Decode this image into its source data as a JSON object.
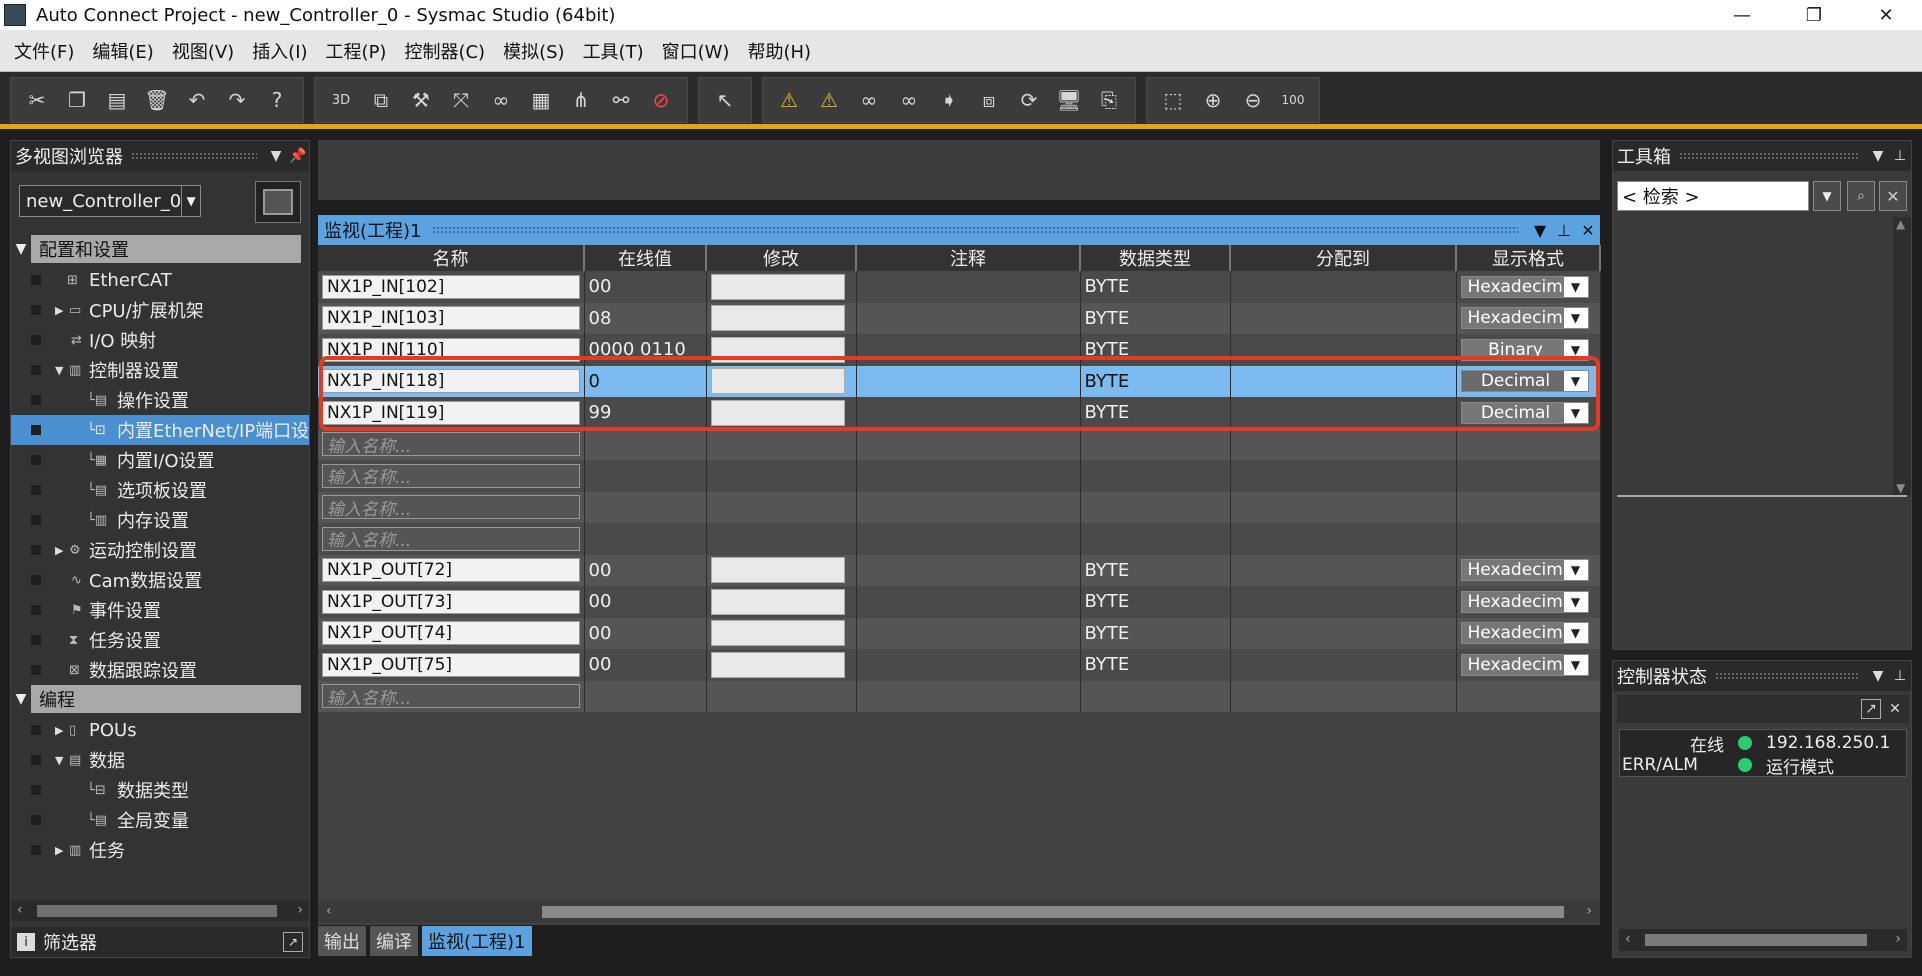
{
  "window": {
    "title": "Auto Connect Project - new_Controller_0 - Sysmac Studio (64bit)",
    "minimize": "—",
    "maximize": "❐",
    "close": "✕"
  },
  "menu": [
    "文件(F)",
    "编辑(E)",
    "视图(V)",
    "插入(I)",
    "工程(P)",
    "控制器(C)",
    "模拟(S)",
    "工具(T)",
    "窗口(W)",
    "帮助(H)"
  ],
  "toolbar": {
    "group1": [
      "scissors-icon",
      "copy-icon",
      "paste-icon",
      "delete-icon",
      "undo-icon",
      "redo-icon",
      "help-icon"
    ],
    "group2": [
      "3d-view-icon",
      "windows-icon",
      "build-icon",
      "cross-ref-icon",
      "glasses-icon",
      "table-icon",
      "structure-icon",
      "binoculars-icon",
      "error-icon"
    ],
    "group3": [
      "arrow-tool-icon"
    ],
    "group4": [
      "warning-icon",
      "warning-cross-icon",
      "watch-icon",
      "watch-cross-icon",
      "transfer-icon",
      "sync-icon",
      "refresh-icon",
      "online-icon",
      "offline-icon"
    ],
    "group5": [
      "fit-icon",
      "zoom-in-icon",
      "zoom-out-icon",
      "zoom-100-icon"
    ],
    "accent_color": "#e3a60f"
  },
  "left_panel": {
    "title": "多视图浏览器",
    "controller": "new_Controller_0",
    "section_config": "配置和设置",
    "section_program": "编程",
    "items": [
      {
        "label": "EtherCAT"
      },
      {
        "label": "CPU/扩展机架"
      },
      {
        "label": "I/O 映射"
      },
      {
        "label": "控制器设置"
      },
      {
        "label": "操作设置"
      },
      {
        "label": "内置EtherNet/IP端口设"
      },
      {
        "label": "内置I/O设置"
      },
      {
        "label": "选项板设置"
      },
      {
        "label": "内存设置"
      },
      {
        "label": "运动控制设置"
      },
      {
        "label": "Cam数据设置"
      },
      {
        "label": "事件设置"
      },
      {
        "label": "任务设置"
      },
      {
        "label": "数据跟踪设置"
      }
    ],
    "program_items": [
      {
        "label": "POUs"
      },
      {
        "label": "数据"
      },
      {
        "label": "数据类型"
      },
      {
        "label": "全局变量"
      },
      {
        "label": "任务"
      }
    ],
    "footer": "筛选器"
  },
  "watch": {
    "title": "监视(工程)1",
    "columns": [
      "名称",
      "在线值",
      "修改",
      "注释",
      "数据类型",
      "分配到",
      "显示格式"
    ],
    "placeholder": "输入名称...",
    "rows": [
      {
        "name": "NX1P_IN[102]",
        "value": "00",
        "type": "BYTE",
        "format": "Hexadecimal"
      },
      {
        "name": "NX1P_IN[103]",
        "value": "08",
        "type": "BYTE",
        "format": "Hexadecimal"
      },
      {
        "name": "NX1P_IN[110]",
        "value": "0000 0110",
        "type": "BYTE",
        "format": "Binary"
      },
      {
        "name": "NX1P_IN[118]",
        "value": "0",
        "type": "BYTE",
        "format": "Decimal"
      },
      {
        "name": "NX1P_IN[119]",
        "value": "99",
        "type": "BYTE",
        "format": "Decimal"
      },
      {
        "name": "NX1P_OUT[72]",
        "value": "00",
        "type": "BYTE",
        "format": "Hexadecimal"
      },
      {
        "name": "NX1P_OUT[73]",
        "value": "00",
        "type": "BYTE",
        "format": "Hexadecimal"
      },
      {
        "name": "NX1P_OUT[74]",
        "value": "00",
        "type": "BYTE",
        "format": "Hexadecimal"
      },
      {
        "name": "NX1P_OUT[75]",
        "value": "00",
        "type": "BYTE",
        "format": "Hexadecimal"
      }
    ],
    "highlight_color": "#e8381e"
  },
  "bottom_tabs": [
    "输出",
    "编译",
    "监视(工程)1"
  ],
  "toolbox": {
    "title": "工具箱",
    "search_placeholder": "< 检索 >"
  },
  "controller_status": {
    "title": "控制器状态",
    "online_label": "在线",
    "ip": "192.168.250.1",
    "err_label": "ERR/ALM",
    "mode": "运行模式",
    "led_color": "#2ecc71"
  }
}
